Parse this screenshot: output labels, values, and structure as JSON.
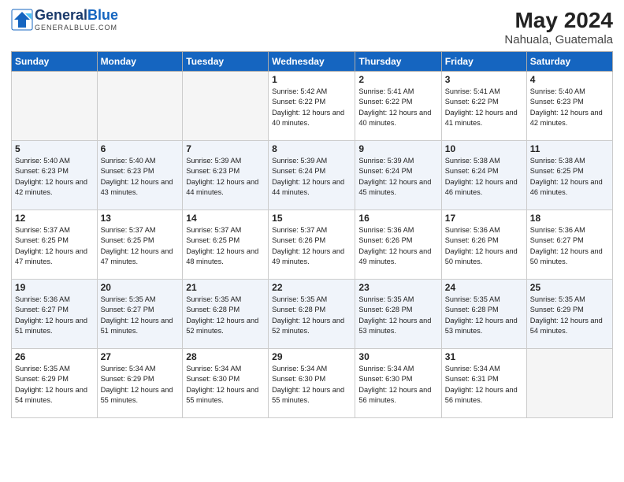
{
  "header": {
    "logo_line1": "General",
    "logo_line2": "Blue",
    "month_year": "May 2024",
    "location": "Nahuala, Guatemala"
  },
  "weekdays": [
    "Sunday",
    "Monday",
    "Tuesday",
    "Wednesday",
    "Thursday",
    "Friday",
    "Saturday"
  ],
  "weeks": [
    [
      {
        "day": "",
        "empty": true
      },
      {
        "day": "",
        "empty": true
      },
      {
        "day": "",
        "empty": true
      },
      {
        "day": "1",
        "sunrise": "5:42 AM",
        "sunset": "6:22 PM",
        "daylight": "12 hours and 40 minutes."
      },
      {
        "day": "2",
        "sunrise": "5:41 AM",
        "sunset": "6:22 PM",
        "daylight": "12 hours and 40 minutes."
      },
      {
        "day": "3",
        "sunrise": "5:41 AM",
        "sunset": "6:22 PM",
        "daylight": "12 hours and 41 minutes."
      },
      {
        "day": "4",
        "sunrise": "5:40 AM",
        "sunset": "6:23 PM",
        "daylight": "12 hours and 42 minutes."
      }
    ],
    [
      {
        "day": "5",
        "sunrise": "5:40 AM",
        "sunset": "6:23 PM",
        "daylight": "12 hours and 42 minutes."
      },
      {
        "day": "6",
        "sunrise": "5:40 AM",
        "sunset": "6:23 PM",
        "daylight": "12 hours and 43 minutes."
      },
      {
        "day": "7",
        "sunrise": "5:39 AM",
        "sunset": "6:23 PM",
        "daylight": "12 hours and 44 minutes."
      },
      {
        "day": "8",
        "sunrise": "5:39 AM",
        "sunset": "6:24 PM",
        "daylight": "12 hours and 44 minutes."
      },
      {
        "day": "9",
        "sunrise": "5:39 AM",
        "sunset": "6:24 PM",
        "daylight": "12 hours and 45 minutes."
      },
      {
        "day": "10",
        "sunrise": "5:38 AM",
        "sunset": "6:24 PM",
        "daylight": "12 hours and 46 minutes."
      },
      {
        "day": "11",
        "sunrise": "5:38 AM",
        "sunset": "6:25 PM",
        "daylight": "12 hours and 46 minutes."
      }
    ],
    [
      {
        "day": "12",
        "sunrise": "5:37 AM",
        "sunset": "6:25 PM",
        "daylight": "12 hours and 47 minutes."
      },
      {
        "day": "13",
        "sunrise": "5:37 AM",
        "sunset": "6:25 PM",
        "daylight": "12 hours and 47 minutes."
      },
      {
        "day": "14",
        "sunrise": "5:37 AM",
        "sunset": "6:25 PM",
        "daylight": "12 hours and 48 minutes."
      },
      {
        "day": "15",
        "sunrise": "5:37 AM",
        "sunset": "6:26 PM",
        "daylight": "12 hours and 49 minutes."
      },
      {
        "day": "16",
        "sunrise": "5:36 AM",
        "sunset": "6:26 PM",
        "daylight": "12 hours and 49 minutes."
      },
      {
        "day": "17",
        "sunrise": "5:36 AM",
        "sunset": "6:26 PM",
        "daylight": "12 hours and 50 minutes."
      },
      {
        "day": "18",
        "sunrise": "5:36 AM",
        "sunset": "6:27 PM",
        "daylight": "12 hours and 50 minutes."
      }
    ],
    [
      {
        "day": "19",
        "sunrise": "5:36 AM",
        "sunset": "6:27 PM",
        "daylight": "12 hours and 51 minutes."
      },
      {
        "day": "20",
        "sunrise": "5:35 AM",
        "sunset": "6:27 PM",
        "daylight": "12 hours and 51 minutes."
      },
      {
        "day": "21",
        "sunrise": "5:35 AM",
        "sunset": "6:28 PM",
        "daylight": "12 hours and 52 minutes."
      },
      {
        "day": "22",
        "sunrise": "5:35 AM",
        "sunset": "6:28 PM",
        "daylight": "12 hours and 52 minutes."
      },
      {
        "day": "23",
        "sunrise": "5:35 AM",
        "sunset": "6:28 PM",
        "daylight": "12 hours and 53 minutes."
      },
      {
        "day": "24",
        "sunrise": "5:35 AM",
        "sunset": "6:28 PM",
        "daylight": "12 hours and 53 minutes."
      },
      {
        "day": "25",
        "sunrise": "5:35 AM",
        "sunset": "6:29 PM",
        "daylight": "12 hours and 54 minutes."
      }
    ],
    [
      {
        "day": "26",
        "sunrise": "5:35 AM",
        "sunset": "6:29 PM",
        "daylight": "12 hours and 54 minutes."
      },
      {
        "day": "27",
        "sunrise": "5:34 AM",
        "sunset": "6:29 PM",
        "daylight": "12 hours and 55 minutes."
      },
      {
        "day": "28",
        "sunrise": "5:34 AM",
        "sunset": "6:30 PM",
        "daylight": "12 hours and 55 minutes."
      },
      {
        "day": "29",
        "sunrise": "5:34 AM",
        "sunset": "6:30 PM",
        "daylight": "12 hours and 55 minutes."
      },
      {
        "day": "30",
        "sunrise": "5:34 AM",
        "sunset": "6:30 PM",
        "daylight": "12 hours and 56 minutes."
      },
      {
        "day": "31",
        "sunrise": "5:34 AM",
        "sunset": "6:31 PM",
        "daylight": "12 hours and 56 minutes."
      },
      {
        "day": "",
        "empty": true
      }
    ]
  ]
}
